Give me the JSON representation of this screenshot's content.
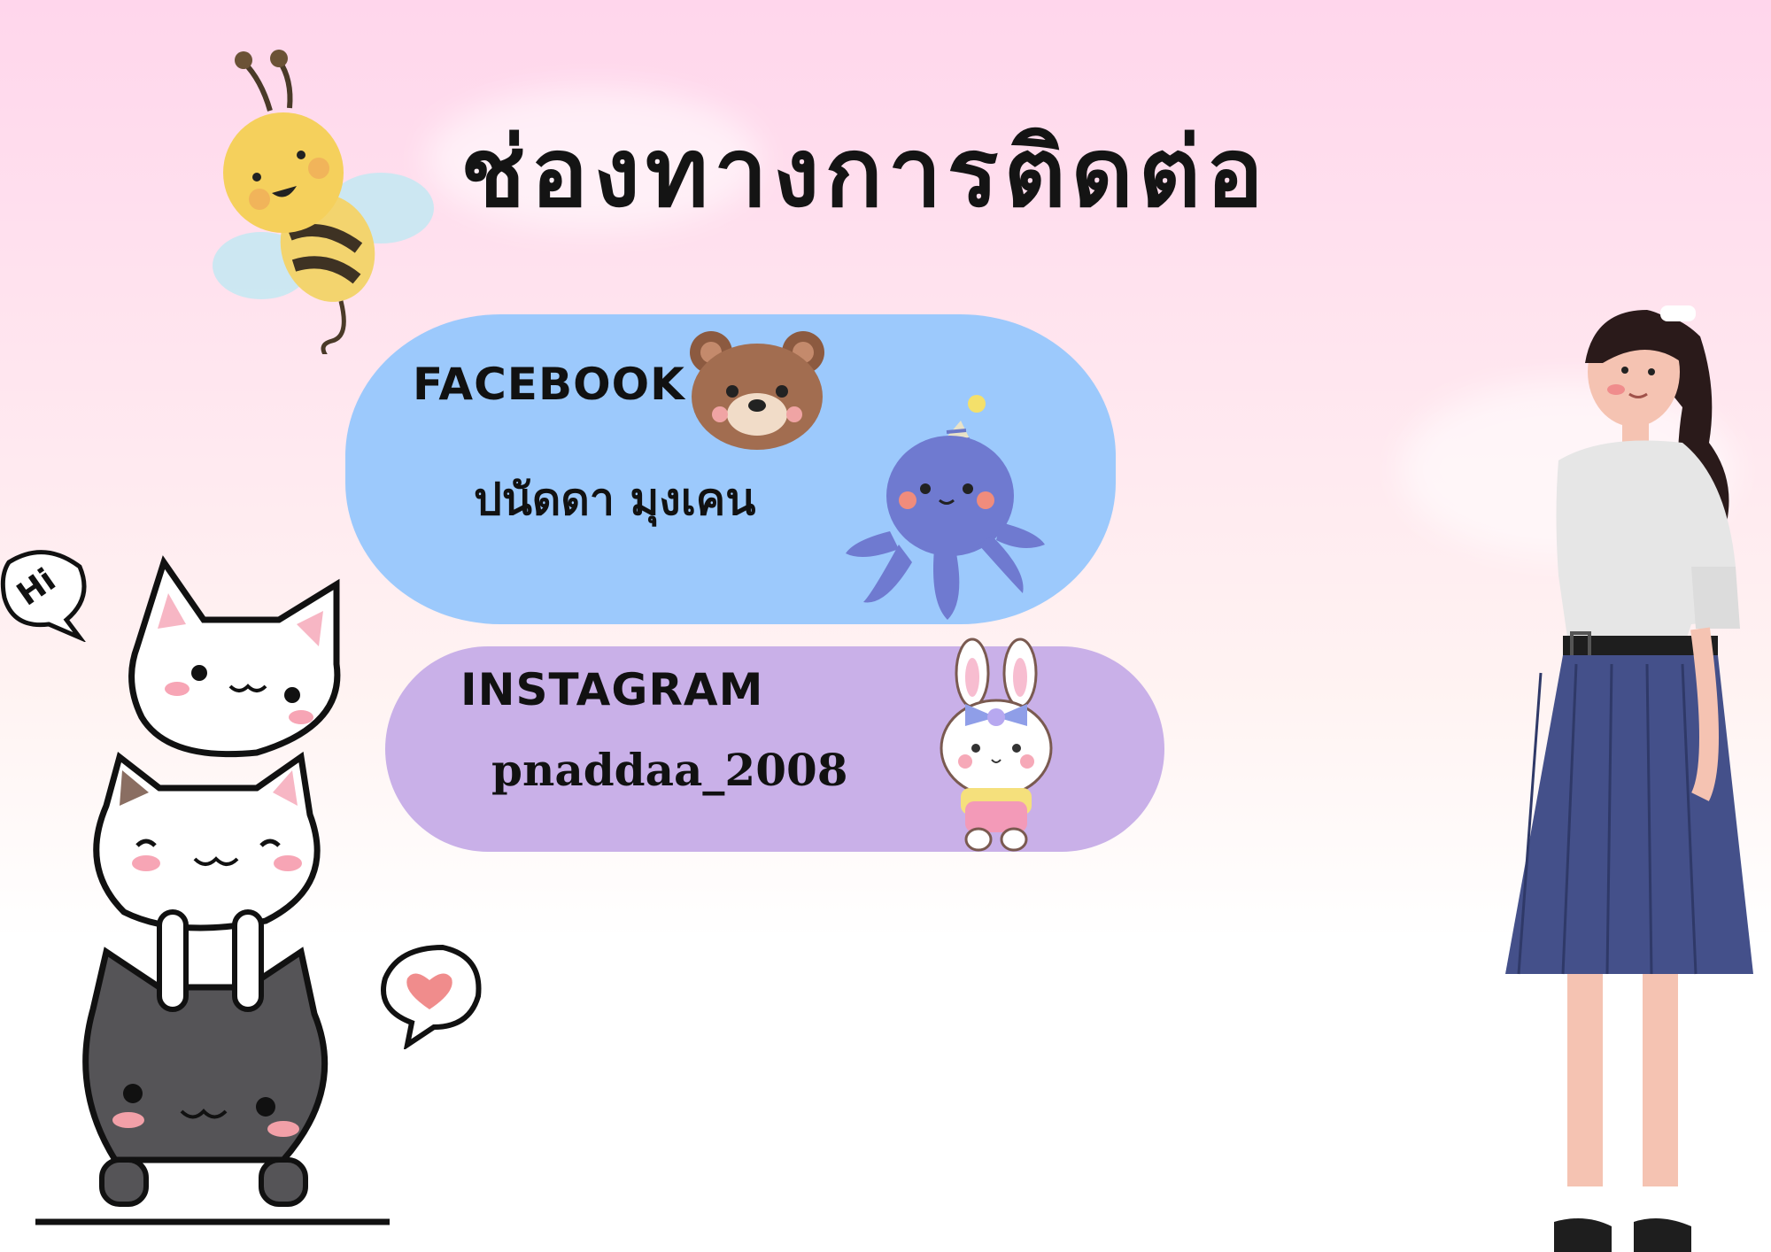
{
  "title": "ช่องทางการติดต่อ",
  "contacts": [
    {
      "platform": "FACEBOOK",
      "value": "ปนัดดา มุงเคน",
      "color": "#9cc9fc"
    },
    {
      "platform": "INSTAGRAM",
      "value": "pnaddaa_2008",
      "color": "#c9b0e8"
    }
  ],
  "decor": {
    "bubble_text": "Hi",
    "icons": [
      "bee-icon",
      "bear-face-icon",
      "octopus-icon",
      "bunny-icon",
      "stacked-cats-illustration",
      "heart-bubble-icon",
      "student-girl-illustration"
    ]
  }
}
